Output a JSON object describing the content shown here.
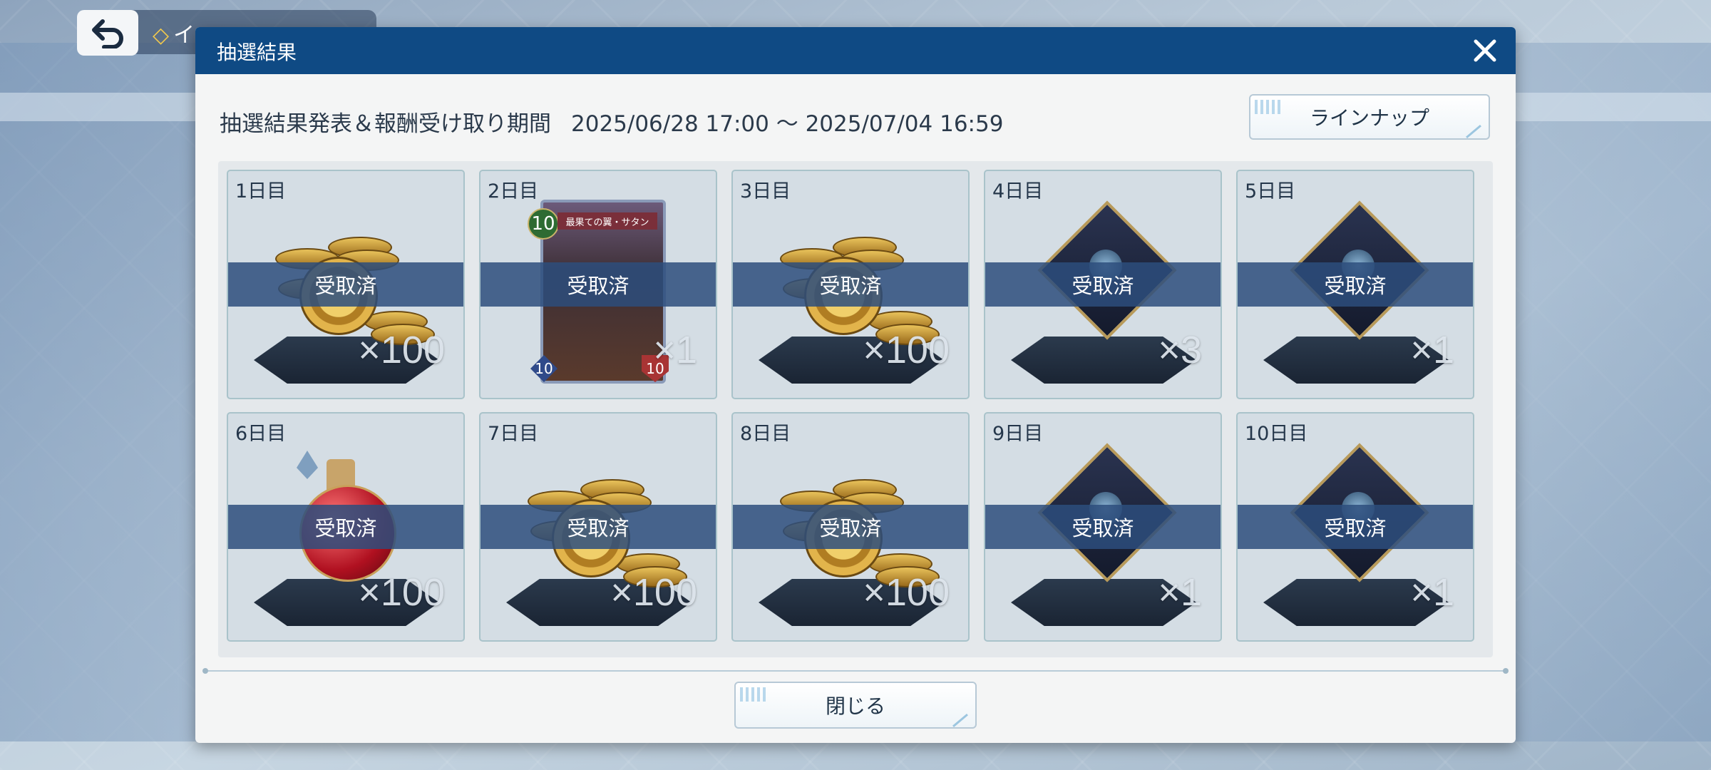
{
  "background": {
    "back_label": "イ"
  },
  "dialog": {
    "title": "抽選結果",
    "period_label": "抽選結果発表＆報酬受け取り期間",
    "period_value": "2025/06/28 17:00 ～ 2025/07/04 16:59",
    "lineup_label": "ラインナップ",
    "close_label": "閉じる",
    "claimed_label": "受取済",
    "items": [
      {
        "day": "1日目",
        "icon": "coins-icon",
        "qty": "×100"
      },
      {
        "day": "2日目",
        "icon": "card-icon",
        "qty": "×1",
        "card_cost": "10",
        "card_name": "最果ての翼・サタン",
        "card_atk": "10",
        "card_def": "10"
      },
      {
        "day": "3日目",
        "icon": "coins-icon",
        "qty": "×100"
      },
      {
        "day": "4日目",
        "icon": "card-pack-icon",
        "qty": "×3"
      },
      {
        "day": "5日目",
        "icon": "card-pack-icon",
        "qty": "×1"
      },
      {
        "day": "6日目",
        "icon": "potion-icon",
        "qty": "×100"
      },
      {
        "day": "7日目",
        "icon": "coins-icon",
        "qty": "×100"
      },
      {
        "day": "8日目",
        "icon": "coins-icon",
        "qty": "×100"
      },
      {
        "day": "9日目",
        "icon": "card-pack-icon",
        "qty": "×1"
      },
      {
        "day": "10日目",
        "icon": "card-pack-icon",
        "qty": "×1"
      }
    ]
  },
  "colors": {
    "header": "#0f4a84",
    "claimed_band": "#2d4e7c",
    "cell_border": "#a9c3ca"
  }
}
